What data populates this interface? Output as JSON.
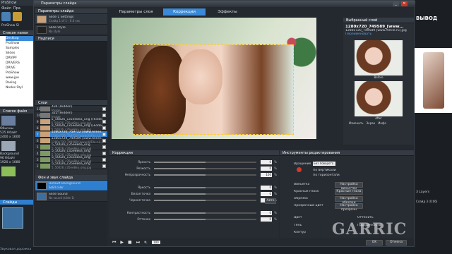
{
  "app": {
    "title": "ProShow",
    "menu": [
      "Файл",
      "Пра"
    ],
    "left_title": "ProShow Sl",
    "folders_label": "Список папок",
    "folders": [
      "Desktop",
      "ProShow",
      "Samples",
      "Slides",
      "DRVIPF",
      "DRIVERS",
      "DRIVE",
      "ProShow",
      "www.jpe",
      "Rasing",
      "Nodes Styl"
    ],
    "files_label": "Список файл",
    "files": [
      "Обычны",
      "525 Кбайт",
      "2400 x 1600",
      "Background",
      "96 Кбайт",
      "1920 x 1080"
    ],
    "slides_label": "Слайды",
    "bottom_text": "Звуковая дорожка",
    "right_title": "ВЫВОД",
    "right_info": "3 Layers",
    "right_info2": "Слайд 3 (0:06)"
  },
  "dialog": {
    "title": "Параметры слайда",
    "slides_header": "Параметры слайда",
    "slide1": {
      "title": "Slide 1 Settings",
      "sub": "Слайд 1 of 1 - 6.0 sec"
    },
    "slide2": {
      "title": "Slide Style",
      "sub": "No style"
    },
    "captions_header": "Надписи",
    "layers_header": "Слои",
    "bg_header": "Фон и звук слайда",
    "bg_item": {
      "title": "Default Background",
      "sub": "Solid color"
    },
    "sound_item": {
      "title": "Slide Sound",
      "sub": "No sound (slide 1)"
    },
    "layers": [
      {
        "name": "434 (Hidden)",
        "sub": "Image"
      },
      {
        "name": "322 (Hidden)",
        "sub": "Image"
      },
      {
        "name": "5_50026_c35ee8ea_orig (Hidden)",
        "sub": "5_50026_c35ee8ea_orig.jpg"
      },
      {
        "name": "5_50026_c35ee8ea_orig (Hidden)",
        "sub": "5_50026_c35ee8ea_orig.jpg"
      },
      {
        "name": "1280x720_759722 [www.AllFile.ru]",
        "sub": "1280x720_759722 [www.AllFile.ru].jpg"
      },
      {
        "name": "1280x720_749589 [www.AllFile.ru]",
        "sub": "1280x720_749589 [www.AllFile.ru].jpg"
      },
      {
        "name": "5_50026_c35ee8ea_orig",
        "sub": "5_50026_c35ee8ea_orig.jpg"
      },
      {
        "name": "5_50026_c35ee8ea_orig",
        "sub": "5_50026_c35ee8ea_orig.jpg"
      },
      {
        "name": "5_50026_c35ee8ea_orig",
        "sub": "5_50026_c35ee8ea_orig.jpg"
      },
      {
        "name": "5_50026_c35ee8ea_orig",
        "sub": "5_50026_c35ee8ea_orig.jpg"
      }
    ],
    "layer_numbers": [
      "11",
      "10",
      "9",
      "8",
      "7",
      "6",
      "5",
      "4",
      "3",
      "2"
    ],
    "tabs": [
      "Параметры слоя",
      "Коррекции",
      "Эффекты"
    ],
    "selected_layer": {
      "header": "Выбранный слой",
      "name": "1280x720_749589_[www...",
      "file": "1280x720_749589 [www.AllFile.ru].jpg",
      "link": "Переименовать",
      "before": "Before",
      "after": "After",
      "buttons": [
        "Изменить",
        "Экран",
        "Инфо"
      ]
    },
    "corrections": {
      "header": "Коррекции",
      "rows": [
        {
          "label": "Яркость",
          "value": "0"
        },
        {
          "label": "Резкость",
          "value": "0"
        },
        {
          "label": "Непрозрачность",
          "value": "100"
        },
        {
          "label": "Яркость",
          "value": "0"
        },
        {
          "label": "Белая точка",
          "value": "0"
        },
        {
          "label": "Черная точка",
          "value": "0"
        },
        {
          "label": "Контрастность",
          "value": "0"
        },
        {
          "label": "Оттенок",
          "value": "0"
        }
      ],
      "auto_btn": "Авто",
      "zoom": "100"
    },
    "tools": {
      "header": "Инструменты редактирования",
      "rotate_label": "Вращение",
      "rotate_value": "Без поворота",
      "flip_v": "По вертикали",
      "flip_h": "По горизонтали",
      "vignette": "Виньетка",
      "vignette_btn": "Настройка виньетки",
      "redeye": "Красные глаза",
      "redeye_btn": "Красные глаза",
      "crop": "Обрезка",
      "crop_btn": "Настройка обрезки",
      "transparent": "Прозрачный цвет",
      "transparent_btn": "Настройка прозрачн",
      "color": "Цвет",
      "tint": "Тень",
      "outline": "Контур",
      "strength": "Оттенить",
      "strength2": "Прозрачность",
      "ok": "OK",
      "cancel": "Отмена"
    }
  },
  "watermark": "GARRIC"
}
